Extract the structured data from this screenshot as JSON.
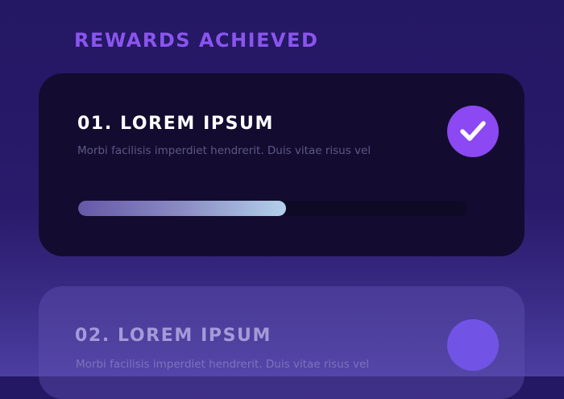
{
  "page": {
    "section_title": "REWARDS ACHIEVED"
  },
  "rewards": [
    {
      "title": "01. LOREM IPSUM",
      "description": "Morbi facilisis imperdiet hendrerit. Duis vitae risus vel",
      "status": "achieved",
      "status_icon": "check-icon",
      "progress": 0.535
    },
    {
      "title": "02. LOREM IPSUM",
      "description": "Morbi facilisis imperdiet hendrerit. Duis vitae risus vel",
      "status": "pending"
    }
  ],
  "colors": {
    "accent": "#8c48f2",
    "section_title": "#8a55ee",
    "card_bg": "#130c30",
    "progress_start": "#6558a8",
    "progress_end": "#b3d0ea"
  }
}
